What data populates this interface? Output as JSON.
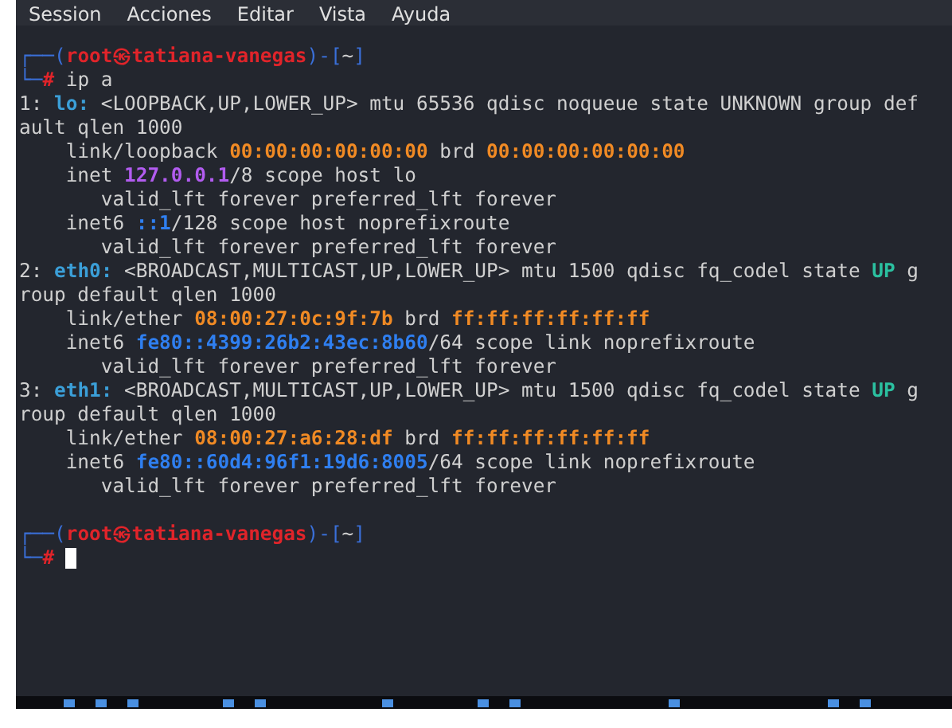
{
  "menu": [
    "Session",
    "Acciones",
    "Editar",
    "Vista",
    "Ayuda"
  ],
  "cursor_visible": true,
  "lines": [
    {
      "segments": [
        {
          "kind": "frame",
          "text": "┌──("
        },
        {
          "kind": "user",
          "text": "root㉿tatiana-vanegas"
        },
        {
          "kind": "frame",
          "text": ")-["
        },
        {
          "kind": "plain",
          "text": "~"
        },
        {
          "kind": "frame",
          "text": "]"
        }
      ]
    },
    {
      "segments": [
        {
          "kind": "frame",
          "text": "└─"
        },
        {
          "kind": "user",
          "text": "#"
        },
        {
          "kind": "plain",
          "text": " ip a"
        }
      ]
    },
    {
      "segments": [
        {
          "kind": "plain",
          "text": "1: "
        },
        {
          "kind": "iface",
          "text": "lo:"
        },
        {
          "kind": "plain",
          "text": " <LOOPBACK,UP,LOWER_UP> mtu 65536 qdisc noqueue state UNKNOWN group def"
        }
      ]
    },
    {
      "segments": [
        {
          "kind": "plain",
          "text": "ault qlen 1000"
        }
      ]
    },
    {
      "segments": [
        {
          "kind": "plain",
          "text": "    link/loopback "
        },
        {
          "kind": "mac",
          "text": "00:00:00:00:00:00"
        },
        {
          "kind": "plain",
          "text": " brd "
        },
        {
          "kind": "mac",
          "text": "00:00:00:00:00:00"
        }
      ]
    },
    {
      "segments": [
        {
          "kind": "plain",
          "text": "    inet "
        },
        {
          "kind": "ipv4",
          "text": "127.0.0.1"
        },
        {
          "kind": "plain",
          "text": "/8 scope host lo"
        }
      ]
    },
    {
      "segments": [
        {
          "kind": "plain",
          "text": "       valid_lft forever preferred_lft forever"
        }
      ]
    },
    {
      "segments": [
        {
          "kind": "plain",
          "text": "    inet6 "
        },
        {
          "kind": "ipv6",
          "text": "::1"
        },
        {
          "kind": "plain",
          "text": "/128 scope host noprefixroute"
        }
      ]
    },
    {
      "segments": [
        {
          "kind": "plain",
          "text": "       valid_lft forever preferred_lft forever"
        }
      ]
    },
    {
      "segments": [
        {
          "kind": "plain",
          "text": "2: "
        },
        {
          "kind": "iface",
          "text": "eth0:"
        },
        {
          "kind": "plain",
          "text": " <BROADCAST,MULTICAST,UP,LOWER_UP> mtu 1500 qdisc fq_codel state "
        },
        {
          "kind": "up",
          "text": "UP"
        },
        {
          "kind": "plain",
          "text": " g"
        }
      ]
    },
    {
      "segments": [
        {
          "kind": "plain",
          "text": "roup default qlen 1000"
        }
      ]
    },
    {
      "segments": [
        {
          "kind": "plain",
          "text": "    link/ether "
        },
        {
          "kind": "mac",
          "text": "08:00:27:0c:9f:7b"
        },
        {
          "kind": "plain",
          "text": " brd "
        },
        {
          "kind": "mac",
          "text": "ff:ff:ff:ff:ff:ff"
        }
      ]
    },
    {
      "segments": [
        {
          "kind": "plain",
          "text": "    inet6 "
        },
        {
          "kind": "ipv6",
          "text": "fe80::4399:26b2:43ec:8b60"
        },
        {
          "kind": "plain",
          "text": "/64 scope link noprefixroute"
        }
      ]
    },
    {
      "segments": [
        {
          "kind": "plain",
          "text": "       valid_lft forever preferred_lft forever"
        }
      ]
    },
    {
      "segments": [
        {
          "kind": "plain",
          "text": "3: "
        },
        {
          "kind": "iface",
          "text": "eth1:"
        },
        {
          "kind": "plain",
          "text": " <BROADCAST,MULTICAST,UP,LOWER_UP> mtu 1500 qdisc fq_codel state "
        },
        {
          "kind": "up",
          "text": "UP"
        },
        {
          "kind": "plain",
          "text": " g"
        }
      ]
    },
    {
      "segments": [
        {
          "kind": "plain",
          "text": "roup default qlen 1000"
        }
      ]
    },
    {
      "segments": [
        {
          "kind": "plain",
          "text": "    link/ether "
        },
        {
          "kind": "mac",
          "text": "08:00:27:a6:28:df"
        },
        {
          "kind": "plain",
          "text": " brd "
        },
        {
          "kind": "mac",
          "text": "ff:ff:ff:ff:ff:ff"
        }
      ]
    },
    {
      "segments": [
        {
          "kind": "plain",
          "text": "    inet6 "
        },
        {
          "kind": "ipv6",
          "text": "fe80::60d4:96f1:19d6:8005"
        },
        {
          "kind": "plain",
          "text": "/64 scope link noprefixroute"
        }
      ]
    },
    {
      "segments": [
        {
          "kind": "plain",
          "text": "       valid_lft forever preferred_lft forever"
        }
      ]
    },
    {
      "kind": "blank"
    },
    {
      "segments": [
        {
          "kind": "frame",
          "text": "┌──("
        },
        {
          "kind": "user",
          "text": "root㉿tatiana-vanegas"
        },
        {
          "kind": "frame",
          "text": ")-["
        },
        {
          "kind": "plain",
          "text": "~"
        },
        {
          "kind": "frame",
          "text": "]"
        }
      ]
    },
    {
      "segments": [
        {
          "kind": "frame",
          "text": "└─"
        },
        {
          "kind": "user",
          "text": "#"
        }
      ]
    }
  ]
}
